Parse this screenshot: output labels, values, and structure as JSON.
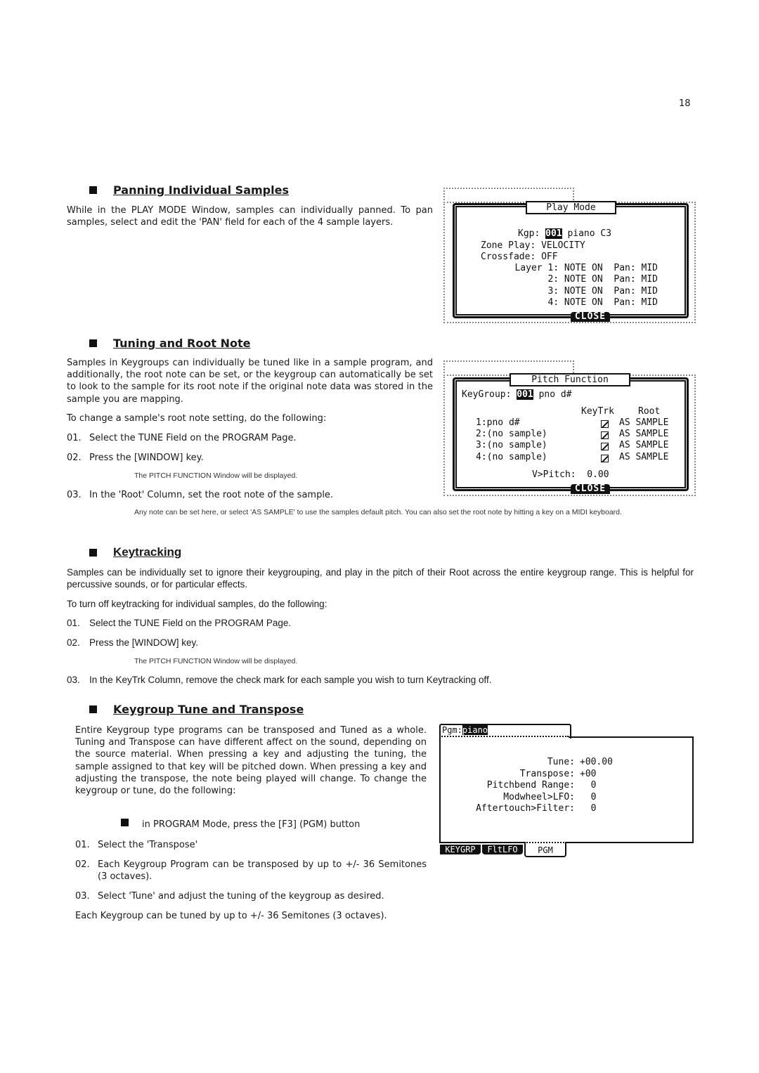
{
  "page_number": "18",
  "sections": {
    "panning": {
      "heading": "Panning Individual Samples",
      "body": "While in the PLAY MODE Window, samples can individually panned.  To pan samples, select and edit the 'PAN' field for each of the 4 sample layers."
    },
    "tuning": {
      "heading": "Tuning and Root Note",
      "body": "Samples in Keygroups can individually be tuned like in a sample program, and additionally, the root note can be set, or the keygroup can automatically be set to look to the sample for its root note if the original note data was stored in the sample you are mapping.",
      "intro": "To change a sample's root note setting, do the following:",
      "steps": [
        {
          "num": "01.",
          "text": "Select the TUNE Field on the PROGRAM Page."
        },
        {
          "num": "02.",
          "text": "Press the [WINDOW] key."
        },
        {
          "num": "03.",
          "text": "In the 'Root' Column, set the root note of the sample."
        }
      ],
      "step2_note": "The PITCH FUNCTION Window will be displayed.",
      "step3_note": "Any note can be set here, or select 'AS SAMPLE' to use the samples default pitch. You can also set the root note by hitting a key on a MIDI keyboard."
    },
    "keytracking": {
      "heading": "Keytracking",
      "body": "Samples can be individually set to ignore their keygrouping, and play in the pitch of their Root  across the entire keygroup range.  This is helpful for percussive sounds, or for particular effects.",
      "intro": "To turn off keytracking for individual samples, do the following:",
      "steps": [
        {
          "num": "01.",
          "text": "Select the TUNE Field on the PROGRAM Page."
        },
        {
          "num": "02.",
          "text": "Press the [WINDOW] key."
        },
        {
          "num": "03.",
          "text": "In the KeyTrk Column, remove the check mark for each sample you wish to turn Keytracking off."
        }
      ],
      "step2_note": "The PITCH FUNCTION Window will be displayed."
    },
    "keygroup_tune": {
      "heading": "Keygroup Tune and Transpose",
      "body": "Entire Keygroup type programs can be transposed and Tuned as a whole. Tuning and Transpose can have different affect on the sound, depending on the source material.  When pressing a key and adjusting the tuning, the sample assigned to that key will be pitched down.  When pressing a key and adjusting the transpose, the note being played will change.  To change the keygroup or tune, do the following:",
      "bullet": "in PROGRAM Mode, press the [F3] (PGM) button",
      "steps": [
        {
          "num": "01.",
          "text": "Select the 'Transpose'"
        },
        {
          "num": "02.",
          "text": "Each Keygroup Program can be transposed by up to +/- 36 Semitones (3 octaves)."
        },
        {
          "num": "03.",
          "text": "Select 'Tune' and adjust the tuning of the keygroup as desired."
        }
      ],
      "footer": "Each Keygroup can be tuned by up to +/- 36 Semitones (3 octaves)."
    }
  },
  "screens": {
    "play_mode": {
      "title": "Play Mode",
      "kgp_label": "Kgp:",
      "kgp_value": "001",
      "kgp_name": "piano C3",
      "zone_label": "Zone Play:",
      "zone_value": "VELOCITY",
      "xfade_label": "Crossfade:",
      "xfade_value": "OFF",
      "layers": [
        {
          "label": "Layer 1:",
          "mode": "NOTE ON",
          "pan_label": "Pan:",
          "pan": "MID"
        },
        {
          "label": "2:",
          "mode": "NOTE ON",
          "pan_label": "Pan:",
          "pan": "MID"
        },
        {
          "label": "3:",
          "mode": "NOTE ON",
          "pan_label": "Pan:",
          "pan": "MID"
        },
        {
          "label": "4:",
          "mode": "NOTE ON",
          "pan_label": "Pan:",
          "pan": "MID"
        }
      ],
      "close": "CLOSE"
    },
    "pitch_function": {
      "title": "Pitch Function",
      "keygroup_label": "KeyGroup:",
      "keygroup_value": "001",
      "keygroup_name": "pno d#",
      "col_keytrk": "KeyTrk",
      "col_root": "Root",
      "rows": [
        {
          "sample": "1:pno d#",
          "keytrk": true,
          "root": "AS SAMPLE"
        },
        {
          "sample": "2:(no sample)",
          "keytrk": true,
          "root": "AS SAMPLE"
        },
        {
          "sample": "3:(no sample)",
          "keytrk": true,
          "root": "AS SAMPLE"
        },
        {
          "sample": "4:(no sample)",
          "keytrk": true,
          "root": "AS SAMPLE"
        }
      ],
      "vpitch_label": "V>Pitch:",
      "vpitch_value": "0.00",
      "close": "CLOSE"
    },
    "program": {
      "pgm_label": "Pgm:",
      "pgm_name": "piano",
      "fields": [
        {
          "label": "Tune:",
          "value": "+00.00"
        },
        {
          "label": "Transpose:",
          "value": "+00"
        },
        {
          "label": "Pitchbend Range:",
          "value": "  0"
        },
        {
          "label": "Modwheel>LFO:",
          "value": "  0"
        },
        {
          "label": "Aftertouch>Filter:",
          "value": "  0"
        }
      ],
      "tabs": [
        "KEYGRP",
        "FltLFO",
        "PGM"
      ]
    }
  }
}
